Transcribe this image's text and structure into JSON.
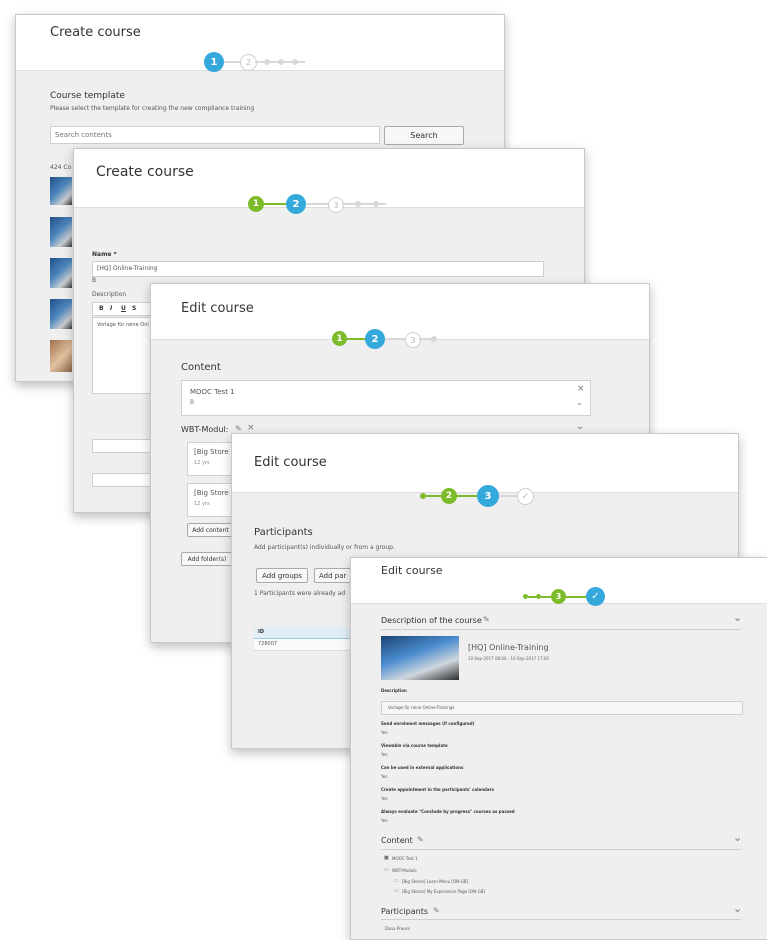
{
  "panel1": {
    "title": "Create course",
    "steps": [
      "1",
      "2"
    ],
    "section_title": "Course template",
    "section_desc": "Please select the template for creating the new compliance training",
    "search_placeholder": "Search contents",
    "search_button": "Search",
    "count_text": "424 Co"
  },
  "panel2": {
    "title": "Create course",
    "steps": [
      "1",
      "2",
      "3"
    ],
    "name_label": "Name *",
    "name_value": "[HQ] Online-Training",
    "name_sub": "B",
    "description_label": "Description",
    "toolbar": [
      "B",
      "I",
      "U",
      "S"
    ],
    "editor_text": "Vorlage für reine Onl"
  },
  "panel3": {
    "title": "Edit course",
    "steps": [
      "1",
      "2",
      "3"
    ],
    "content_label": "Content",
    "content_value": "MOOC Test 1",
    "content_sub": "B",
    "wbt_label": "WBT-Modul:",
    "item1_title": "[Big Store",
    "item1_sub": "12 yrs",
    "item2_title": "[Big Store",
    "item2_sub": "12 yrs",
    "add_content_button": "Add content",
    "add_folder_button": "Add folder(s)"
  },
  "panel4": {
    "title": "Edit course",
    "steps": [
      "2",
      "3"
    ],
    "section_title": "Participants",
    "section_desc": "Add participant(s) individually or from a group.",
    "add_groups_button": "Add groups",
    "add_part_button": "Add par",
    "info_text": "1 Participants were already ad",
    "col_header": "ID",
    "row_value": "728007"
  },
  "panel5": {
    "title": "Edit course",
    "steps": [
      "3"
    ],
    "section_description": "Description of the course",
    "course_name": "[HQ] Online-Training",
    "course_dates": "10-Sep-2017 08:00 - 10-Sep-2017 17:00",
    "fields": [
      {
        "label": "Description",
        "value": "Vorlage für reine Online-Trainings"
      },
      {
        "label": "Send enrolment messages (if configured)",
        "value": "Yes"
      },
      {
        "label": "Viewable via course template",
        "value": "Yes"
      },
      {
        "label": "Can be used in external applications",
        "value": "Yes"
      },
      {
        "label": "Create appointment in the participants' calendars",
        "value": "Yes"
      },
      {
        "label": "Always evaluate \"Conclude by progress\" courses as passed",
        "value": "Yes"
      }
    ],
    "section_content": "Content",
    "content_items": [
      "MOOC Test 1",
      "WBT-Module",
      "[Big Stores] Learn Menu [ON-GB]",
      "[Big Stores] My Experience Page [ON-GB]"
    ],
    "section_participants": "Participants",
    "participant_name": "Dana Preuss"
  }
}
